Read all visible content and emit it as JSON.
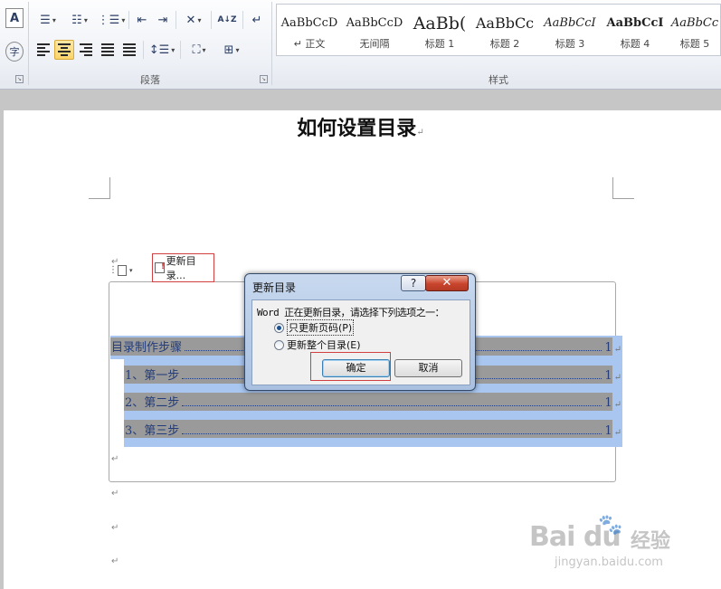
{
  "ribbon": {
    "paragraph_group_label": "段落",
    "styles_group_label": "样式",
    "left_glyphs": [
      "A",
      "字"
    ],
    "sort_glyph": "A↓Z",
    "styles": [
      {
        "sample": "AaBbCcD",
        "name": "↵ 正文"
      },
      {
        "sample": "AaBbCcD",
        "name": "无间隔"
      },
      {
        "sample": "AaBb(",
        "name": "标题 1"
      },
      {
        "sample": "AaBbCc",
        "name": "标题 2"
      },
      {
        "sample": "AaBbCcI",
        "name": "标题 3"
      },
      {
        "sample": "AaBbCcI",
        "name": "标题 4"
      },
      {
        "sample": "AaBbCc",
        "name": "标题 5"
      }
    ]
  },
  "document": {
    "title": "如何设置目录",
    "paragraph_mark": "↵",
    "toc_toolbar": {
      "handle": "⋮",
      "update_label": "更新目录..."
    },
    "toc_entries": [
      {
        "text": "目录制作步骤",
        "page": "1"
      },
      {
        "text": "1、第一步",
        "page": "1"
      },
      {
        "text": "2、第二步",
        "page": "1"
      },
      {
        "text": "3、第三步",
        "page": "1"
      }
    ]
  },
  "dialog": {
    "title": "更新目录",
    "help": "?",
    "close": "✕",
    "message": "Word 正在更新目录，请选择下列选项之一：",
    "option_page_numbers": "只更新页码(P)",
    "option_entire": "更新整个目录(E)",
    "selected": "page_numbers",
    "ok": "确定",
    "cancel": "取消"
  },
  "watermark": {
    "logo": "Bai du",
    "jingyan": "经验",
    "url": "jingyan.baidu.com"
  }
}
